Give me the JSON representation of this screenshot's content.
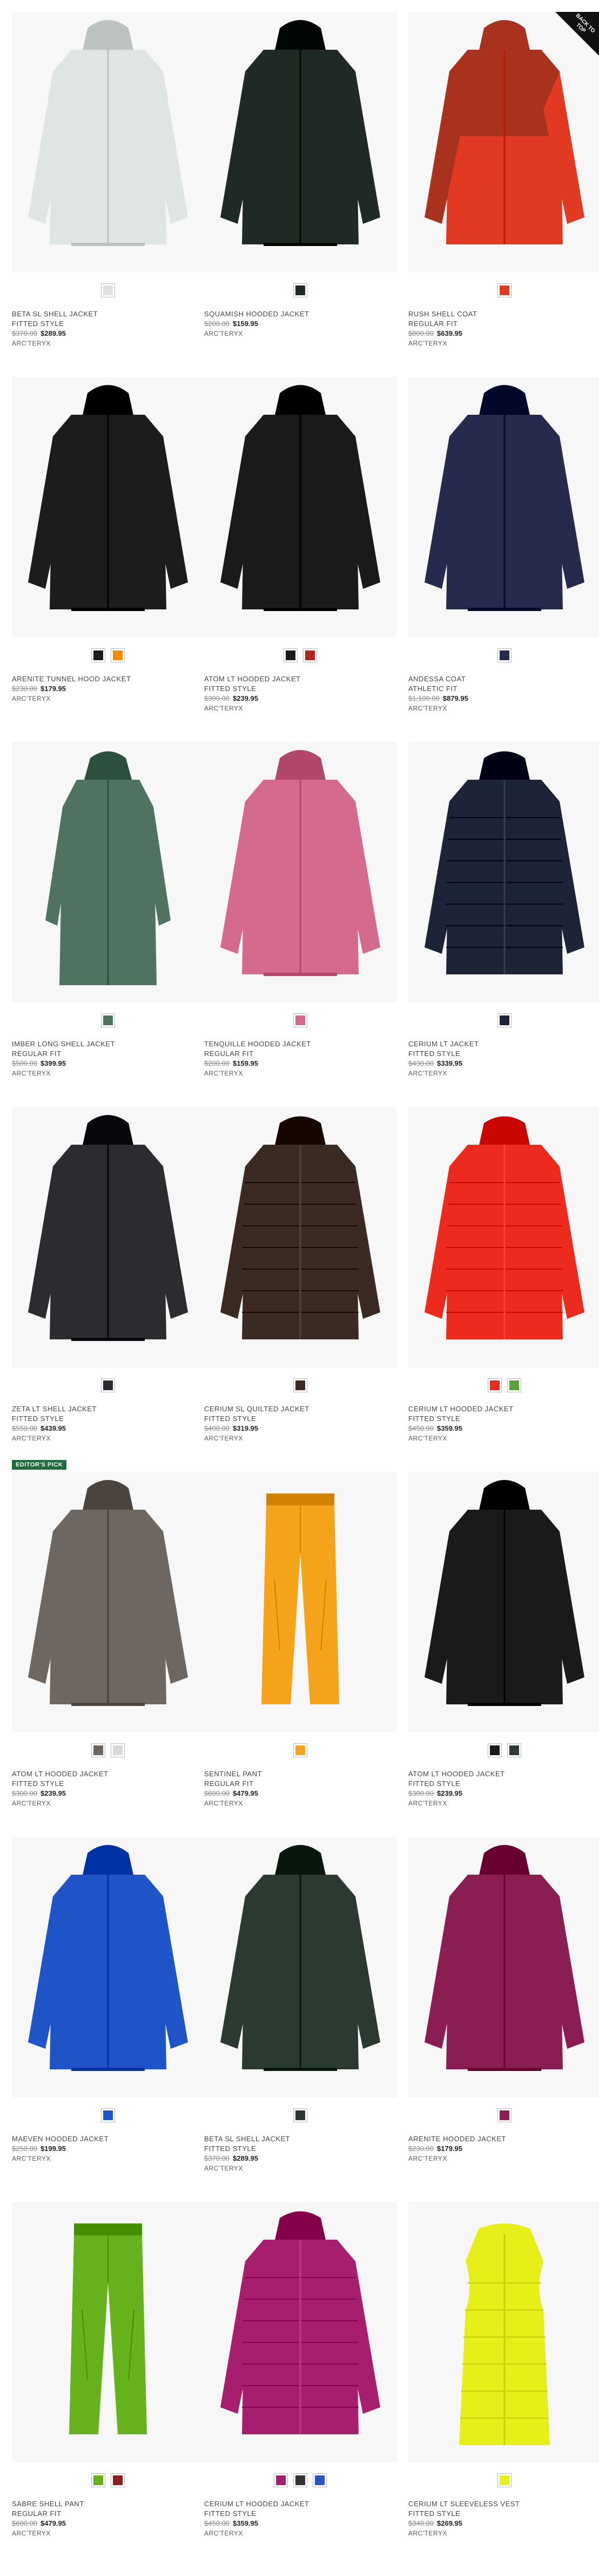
{
  "back_to_top": "BACK TO TOP",
  "editors_pick": "EDITOR'S PICK",
  "products": [
    {
      "name": "BETA SL SHELL JACKET",
      "fit": "FITTED STYLE",
      "old": "$370.00",
      "new": "$289.95",
      "brand": "ARC'TERYX",
      "color": "#dfe6e2",
      "type": "jacket",
      "swatches": [
        "#dfe2df"
      ]
    },
    {
      "name": "SQUAMISH HOODED JACKET",
      "fit": "",
      "old": "$200.00",
      "new": "$159.95",
      "brand": "ARC'TERYX",
      "color": "#1f2a25",
      "type": "jacket",
      "swatches": [
        "#1f2a25"
      ]
    },
    {
      "name": "RUSH SHELL COAT",
      "fit": "REGULAR FIT",
      "old": "$800.00",
      "new": "$639.95",
      "brand": "ARC'TERYX",
      "color": "#e23a22",
      "type": "jacket2",
      "swatches": [
        "#e23a22"
      ]
    },
    {
      "name": "ARENITE TUNNEL HOOD JACKET",
      "fit": "",
      "old": "$230.00",
      "new": "$179.95",
      "brand": "ARC'TERYX",
      "color": "#1c1c1c",
      "type": "jacket",
      "swatches": [
        "#1c1c1c",
        "#f08a00"
      ]
    },
    {
      "name": "ATOM LT HOODED JACKET",
      "fit": "FITTED STYLE",
      "old": "$300.00",
      "new": "$239.95",
      "brand": "ARC'TERYX",
      "color": "#1a1a1a",
      "type": "jacket",
      "swatches": [
        "#1a1a1a",
        "#b3261e"
      ]
    },
    {
      "name": "ANDESSA COAT",
      "fit": "ATHLETIC FIT",
      "old": "$1,100.00",
      "new": "$879.95",
      "brand": "ARC'TERYX",
      "color": "#262a4c",
      "type": "jacket",
      "swatches": [
        "#262a4c"
      ]
    },
    {
      "name": "IMBER LONG SHELL JACKET",
      "fit": "REGULAR FIT",
      "old": "$500.00",
      "new": "$399.95",
      "brand": "ARC'TERYX",
      "color": "#4f7360",
      "type": "coat",
      "swatches": [
        "#4f7360"
      ]
    },
    {
      "name": "TENQUILLE HOODED JACKET",
      "fit": "REGULAR FIT",
      "old": "$200.00",
      "new": "$159.95",
      "brand": "ARC'TERYX",
      "color": "#d46a8c",
      "type": "jacket",
      "swatches": [
        "#d46a8c"
      ]
    },
    {
      "name": "CERIUM LT JACKET",
      "fit": "FITTED STYLE",
      "old": "$430.00",
      "new": "$339.95",
      "brand": "ARC'TERYX",
      "color": "#1e2438",
      "type": "puffer",
      "swatches": [
        "#1e2438"
      ]
    },
    {
      "name": "ZETA LT SHELL JACKET",
      "fit": "FITTED STYLE",
      "old": "$550.00",
      "new": "$439.95",
      "brand": "ARC'TERYX",
      "color": "#2a2c30",
      "type": "jacket",
      "swatches": [
        "#2a2c30"
      ]
    },
    {
      "name": "CERIUM SL QUILTED JACKET",
      "fit": "FITTED STYLE",
      "old": "$400.00",
      "new": "$319.95",
      "brand": "ARC'TERYX",
      "color": "#3a2a22",
      "type": "puffer",
      "swatches": [
        "#3a2a22"
      ]
    },
    {
      "name": "CERIUM LT HOODED JACKET",
      "fit": "FITTED STYLE",
      "old": "$450.00",
      "new": "$359.95",
      "brand": "ARC'TERYX",
      "color": "#ec2a1e",
      "type": "puffer",
      "swatches": [
        "#ec2a1e",
        "#5aa03c"
      ]
    },
    {
      "name": "ATOM LT HOODED JACKET",
      "fit": "FITTED STYLE",
      "old": "$300.00",
      "new": "$239.95",
      "brand": "ARC'TERYX",
      "color": "#6e6660",
      "type": "jacket",
      "swatches": [
        "#6e6660",
        "#d8d8d8"
      ],
      "pick": true
    },
    {
      "name": "SENTINEL PANT",
      "fit": "REGULAR FIT",
      "old": "$600.00",
      "new": "$479.95",
      "brand": "ARC'TERYX",
      "color": "#f5a31a",
      "type": "pant",
      "swatches": [
        "#f5a31a"
      ]
    },
    {
      "name": "ATOM LT HOODED JACKET",
      "fit": "FITTED STYLE",
      "old": "$300.00",
      "new": "$239.95",
      "brand": "ARC'TERYX",
      "color": "#1a1a1a",
      "type": "jacket",
      "swatches": [
        "#1a1a1a",
        "#2e3a38"
      ]
    },
    {
      "name": "MAEVEN HOODED JACKET",
      "fit": "",
      "old": "$250.00",
      "new": "$199.95",
      "brand": "ARC'TERYX",
      "color": "#1f54c8",
      "type": "jacket",
      "swatches": [
        "#1f54c8"
      ]
    },
    {
      "name": "BETA SL SHELL JACKET",
      "fit": "FITTED STYLE",
      "old": "$370.00",
      "new": "$289.95",
      "brand": "ARC'TERYX",
      "color": "#2a3a30",
      "type": "jacket",
      "swatches": [
        "#2a3a30"
      ]
    },
    {
      "name": "ARENITE HOODED JACKET",
      "fit": "",
      "old": "$230.00",
      "new": "$179.95",
      "brand": "ARC'TERYX",
      "color": "#8a1e52",
      "type": "jacket",
      "swatches": [
        "#8a1e52"
      ]
    },
    {
      "name": "SABRE SHELL PANT",
      "fit": "REGULAR FIT",
      "old": "$600.00",
      "new": "$479.95",
      "brand": "ARC'TERYX",
      "color": "#66b21c",
      "type": "pant",
      "swatches": [
        "#66b21c",
        "#8a1e1e"
      ]
    },
    {
      "name": "CERIUM LT HOODED JACKET",
      "fit": "FITTED STYLE",
      "old": "$450.00",
      "new": "$359.95",
      "brand": "ARC'TERYX",
      "color": "#a81e6e",
      "type": "puffer",
      "swatches": [
        "#a81e6e",
        "#333333",
        "#2d55c2"
      ]
    },
    {
      "name": "CERIUM LT SLEEVELESS VEST",
      "fit": "FITTED STYLE",
      "old": "$340.00",
      "new": "$269.95",
      "brand": "ARC'TERYX",
      "color": "#e6f018",
      "type": "vest",
      "swatches": [
        "#e6f018"
      ]
    }
  ]
}
